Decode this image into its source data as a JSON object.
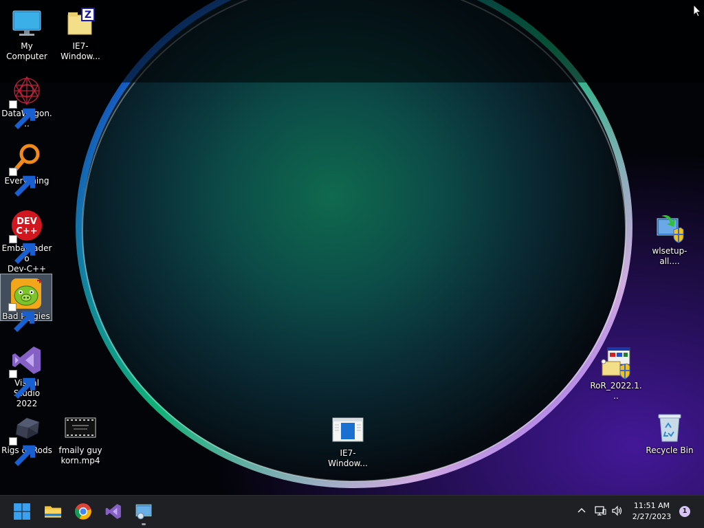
{
  "desktop_icons": {
    "my_computer": "My Computer",
    "ie7_zip": "IE7-Window...",
    "datawagon": "DataWagon...",
    "everything": "Everything",
    "devcpp": "Embarcadero\nDev-C++",
    "bad_piggies": "Bad Piggies",
    "visual_studio": "Visual Studio\n2022",
    "rigs_of_rods": "Rigs of Rods",
    "fmaily_video": "fmaily guy\nkorn.mp4",
    "ie7_installer": "IE7-Window...",
    "wlsetup": "wlsetup-all....",
    "ror_setup": "RoR_2022.1...",
    "recycle_bin": "Recycle Bin"
  },
  "taskbar": {
    "apps": [
      "start-button",
      "file-explorer",
      "chrome",
      "visual-studio",
      "setup-app"
    ],
    "tray": {
      "time": "11:51 AM",
      "date": "2/27/2023",
      "notification_count": "1"
    }
  },
  "colors": {
    "taskbar_bg": "#1f2024",
    "accent": "#0078d4",
    "selection": "#78a0b4"
  }
}
